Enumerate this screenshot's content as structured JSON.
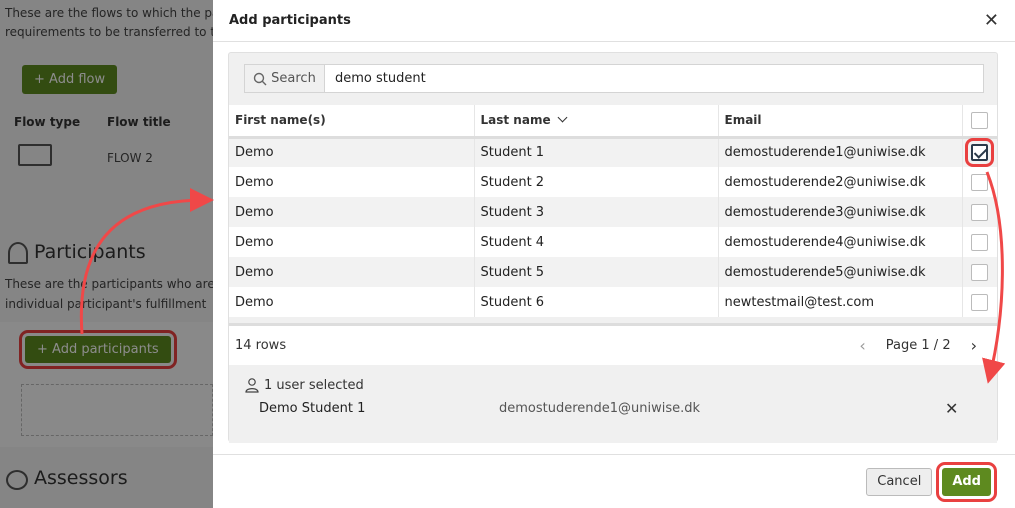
{
  "background": {
    "flows_desc_line1": "These are the flows to which the pa",
    "flows_desc_line2": "requirements to be transferred to th",
    "add_flow_button": "+ Add flow",
    "col_flow_type": "Flow type",
    "col_flow_title": "Flow title",
    "flow_row_title": "FLOW 2",
    "participants_heading": "Participants",
    "participants_desc_line1": "These are the participants who are",
    "participants_desc_line2": "individual participant's fulfillment",
    "add_participants_button": "+ Add participants",
    "assessors_heading": "Assessors"
  },
  "modal": {
    "title": "Add participants",
    "search": {
      "label": "Search",
      "value": "demo student"
    },
    "table": {
      "headers": {
        "first": "First name(s)",
        "last": "Last name",
        "email": "Email"
      },
      "rows": [
        {
          "first": "Demo",
          "last": "Student 1",
          "email": "demostuderende1@uniwise.dk",
          "checked": true
        },
        {
          "first": "Demo",
          "last": "Student 2",
          "email": "demostuderende2@uniwise.dk",
          "checked": false
        },
        {
          "first": "Demo",
          "last": "Student 3",
          "email": "demostuderende3@uniwise.dk",
          "checked": false
        },
        {
          "first": "Demo",
          "last": "Student 4",
          "email": "demostuderende4@uniwise.dk",
          "checked": false
        },
        {
          "first": "Demo",
          "last": "Student 5",
          "email": "demostuderende5@uniwise.dk",
          "checked": false
        },
        {
          "first": "Demo",
          "last": "Student 6",
          "email": "newtestmail@test.com",
          "checked": false
        }
      ]
    },
    "row_count": "14 rows",
    "page_label": "Page 1 / 2",
    "selected": {
      "title": "1 user selected",
      "name": "Demo Student 1",
      "email": "demostuderende1@uniwise.dk"
    },
    "cancel_label": "Cancel",
    "add_label": "Add"
  },
  "colors": {
    "accent_green": "#5e8a1f",
    "highlight_red": "#e94040"
  }
}
